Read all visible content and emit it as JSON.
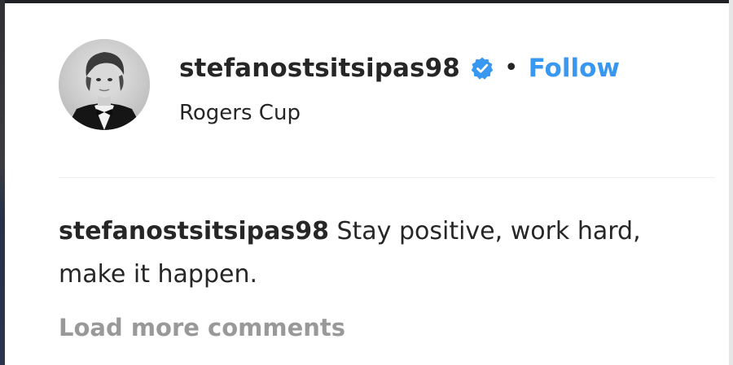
{
  "post_header": {
    "username": "stefanostsitsipas98",
    "verified_icon": "verified-badge-icon",
    "separator": "•",
    "follow_label": "Follow",
    "location": "Rogers Cup"
  },
  "caption": {
    "author": "stefanostsitsipas98",
    "text": " Stay positive, work hard, make it happen."
  },
  "comments": {
    "load_more_label": "Load more comments"
  },
  "colors": {
    "primary_text": "#262626",
    "link_blue": "#3897f0",
    "muted_text": "#999999",
    "divider": "#efefef"
  }
}
